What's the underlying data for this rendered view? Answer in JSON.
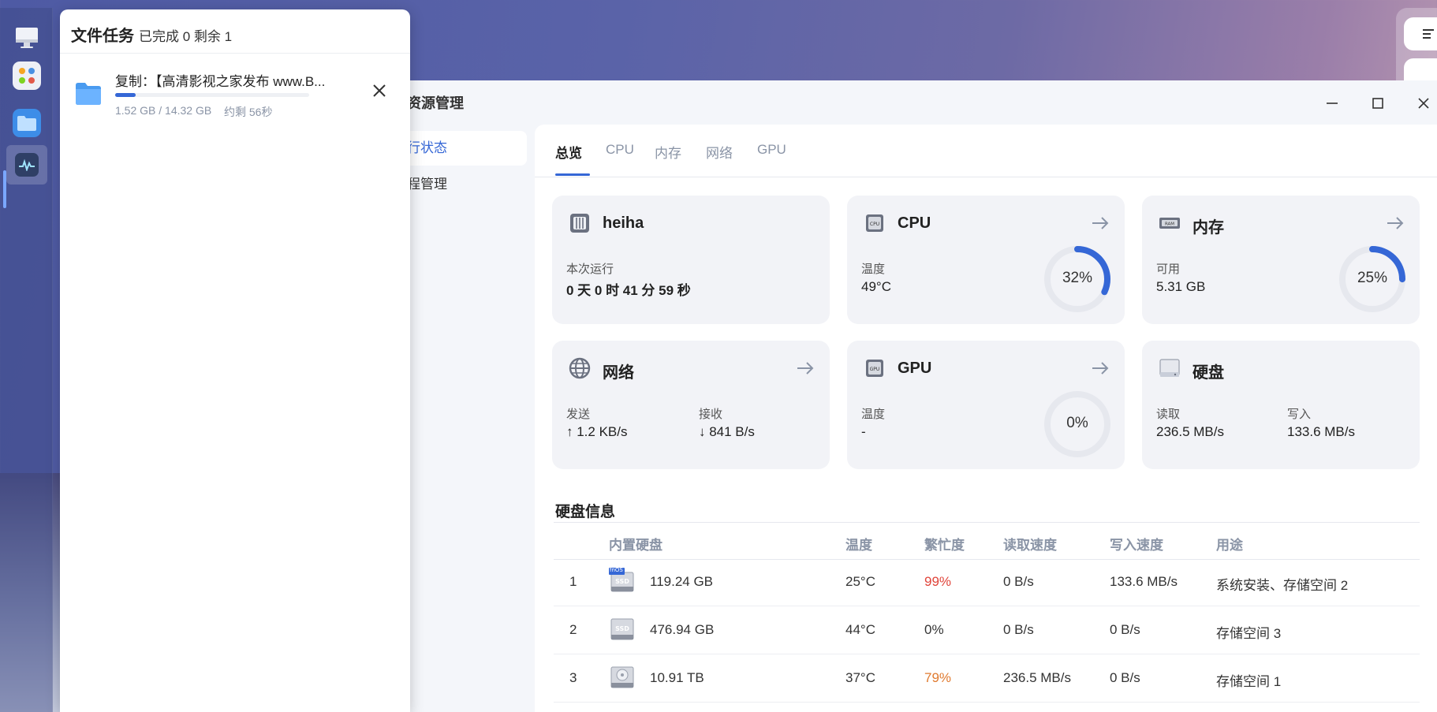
{
  "app": {
    "title": "资源管理",
    "sidebar": [
      {
        "label": "行状态",
        "active": true
      },
      {
        "label": "程管理",
        "active": false
      }
    ],
    "tabs": [
      {
        "label": "总览",
        "active": true
      },
      {
        "label": "CPU",
        "active": false
      },
      {
        "label": "内存",
        "active": false
      },
      {
        "label": "网络",
        "active": false
      },
      {
        "label": "GPU",
        "active": false
      }
    ]
  },
  "cards": {
    "system": {
      "title": "heiha",
      "uptime_label": "本次运行",
      "uptime_value": "0 天 0 时 41 分 59 秒",
      "icon": "server-icon"
    },
    "cpu": {
      "title": "CPU",
      "temp_label": "温度",
      "temp_value": "49°C",
      "usage": "32%",
      "usage_fraction": 0.32,
      "icon": "cpu-chip-icon"
    },
    "memory": {
      "title": "内存",
      "avail_label": "可用",
      "avail_value": "5.31 GB",
      "usage": "25%",
      "usage_fraction": 0.25,
      "icon": "ram-icon"
    },
    "network": {
      "title": "网络",
      "send_label": "发送",
      "send_value": "↑ 1.2 KB/s",
      "recv_label": "接收",
      "recv_value": "↓ 841 B/s",
      "icon": "globe-icon"
    },
    "gpu": {
      "title": "GPU",
      "temp_label": "温度",
      "temp_value": "-",
      "usage": "0%",
      "usage_fraction": 0.0,
      "icon": "gpu-chip-icon"
    },
    "disk": {
      "title": "硬盘",
      "read_label": "读取",
      "read_value": "236.5 MB/s",
      "write_label": "写入",
      "write_value": "133.6 MB/s",
      "icon": "disk-icon"
    }
  },
  "disk_info": {
    "title": "硬盘信息",
    "columns": [
      "内置硬盘",
      "温度",
      "繁忙度",
      "读取速度",
      "写入速度",
      "用途"
    ],
    "rows": [
      {
        "index": "1",
        "capacity": "119.24 GB",
        "temp": "25°C",
        "busy": "99%",
        "busy_color": "#e0443a",
        "read": "0 B/s",
        "write": "133.6 MB/s",
        "usage": "系统安装、存储空间 2",
        "icon": "ssd-fnos-icon",
        "badge": "fnOS"
      },
      {
        "index": "2",
        "capacity": "476.94 GB",
        "temp": "44°C",
        "busy": "0%",
        "busy_color": "#333333",
        "read": "0 B/s",
        "write": "0 B/s",
        "usage": "存储空间 3",
        "icon": "ssd-icon"
      },
      {
        "index": "3",
        "capacity": "10.91 TB",
        "temp": "37°C",
        "busy": "79%",
        "busy_color": "#e07a2f",
        "read": "236.5 MB/s",
        "write": "0 B/s",
        "usage": "存储空间 1",
        "icon": "hdd-icon"
      }
    ]
  },
  "file_tasks": {
    "title": "文件任务",
    "summary": "已完成 0 剩余 1",
    "task": {
      "name": "复制：【高清影视之家发布 www.B...",
      "progress_text": "1.52 GB / 14.32 GB",
      "eta": "约剩 56秒",
      "progress_fraction": 0.106
    }
  },
  "colors": {
    "accent": "#3567d6",
    "busy_high": "#e0443a",
    "busy_mid": "#e07a2f"
  }
}
